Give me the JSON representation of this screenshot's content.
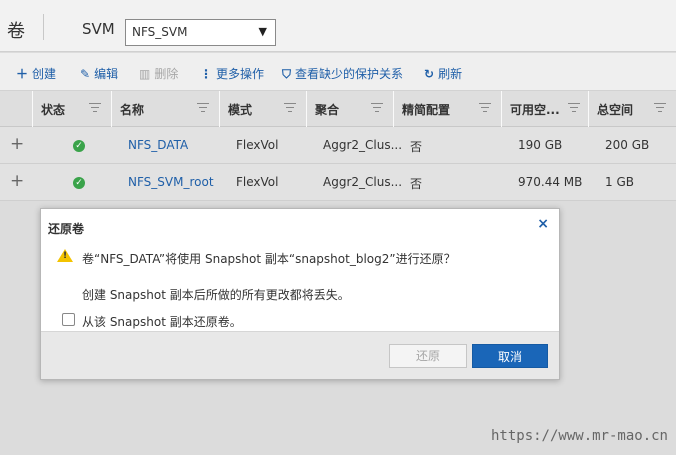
{
  "header": {
    "title": "卷",
    "svm_label": "SVM",
    "svm_selected": "NFS_SVM"
  },
  "toolbar": {
    "create": "创建",
    "edit": "编辑",
    "delete": "删除",
    "more_actions": "更多操作",
    "view_missing_protection": "查看缺少的保护关系",
    "refresh": "刷新"
  },
  "table": {
    "columns": [
      "状态",
      "名称",
      "模式",
      "聚合",
      "精简配置",
      "可用空...",
      "总空间"
    ],
    "rows": [
      {
        "status": "ok",
        "name": "NFS_DATA",
        "mode": "FlexVol",
        "aggregate": "Aggr2_Clus...",
        "thin": "否",
        "available": "190 GB",
        "total": "200 GB"
      },
      {
        "status": "ok",
        "name": "NFS_SVM_root",
        "mode": "FlexVol",
        "aggregate": "Aggr2_Clus...",
        "thin": "否",
        "available": "970.44 MB",
        "total": "1 GB"
      }
    ]
  },
  "dialog": {
    "title": "还原卷",
    "close": "×",
    "message": "卷“NFS_DATA”将使用 Snapshot 副本“snapshot_blog2”进行还原？",
    "sub_message": "创建 Snapshot 副本后所做的所有更改都将丢失。",
    "checkbox_label": "从该 Snapshot 副本还原卷。",
    "checkbox_checked": false,
    "restore_button": "还原",
    "cancel_button": "取消"
  },
  "watermark": "https://www.mr-mao.cn",
  "colors": {
    "accent": "#1f5fa8",
    "primary_button": "#1a66b8",
    "ok": "#3aa34a",
    "warning": "#f3c300"
  }
}
